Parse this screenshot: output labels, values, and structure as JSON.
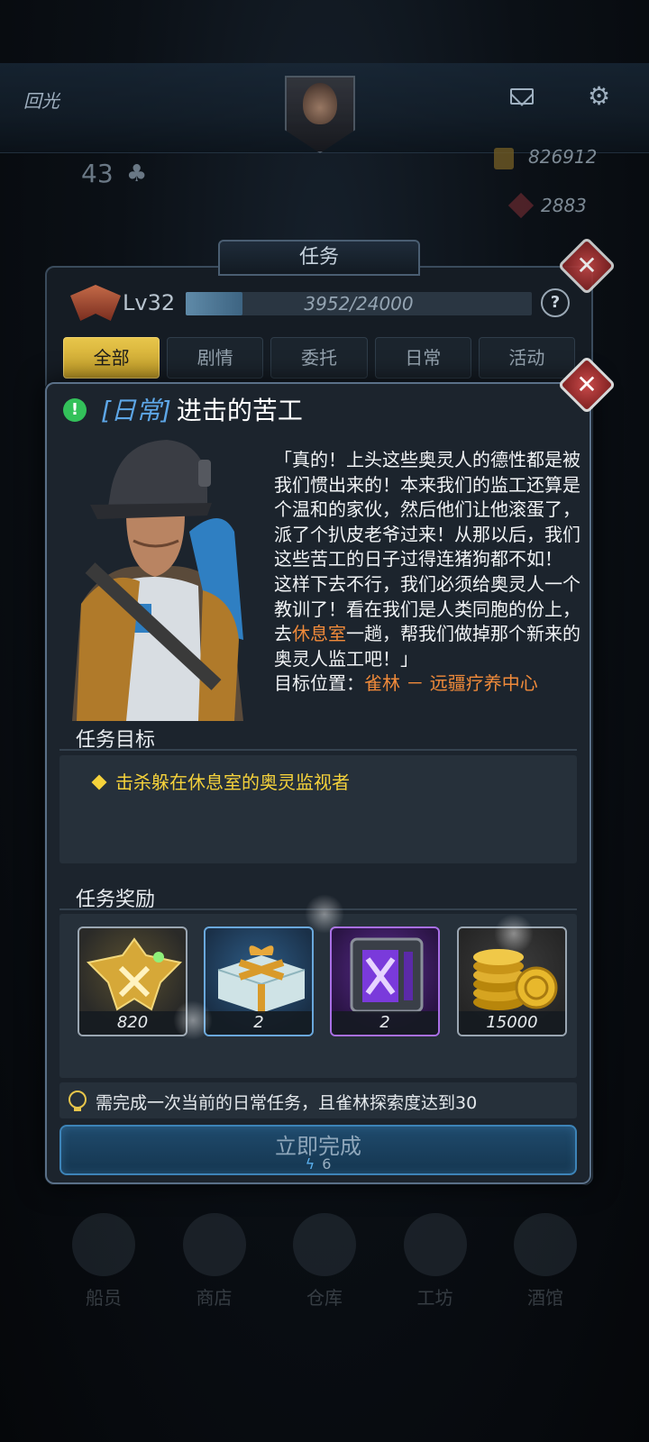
{
  "background": {
    "player_name": "回光",
    "player_level": "43",
    "gold": "826912",
    "gems": "2883",
    "nav": [
      "船员",
      "商店",
      "仓库",
      "工坊",
      "酒馆"
    ]
  },
  "tasks_panel": {
    "title": "任务",
    "level_label": "Lv32",
    "xp_text": "3952/24000",
    "xp_fraction": 0.165,
    "help": "?",
    "tabs": [
      "全部",
      "剧情",
      "委托",
      "日常",
      "活动"
    ],
    "active_tab": 0
  },
  "dialog": {
    "task_type": "[日常]",
    "task_name": "进击的苦工",
    "story_part1": "「真的！上头这些奥灵人的德性都是被我们惯出来的！本来我们的监工还算是个温和的家伙，然后他们让他滚蛋了，派了个扒皮老爷过来！从那以后，我们这些苦工的日子过得连猪狗都不如！\n这样下去不行，我们必须给奥灵人一个教训了！看在我们是人类同胞的份上，去",
    "story_highlight": "休息室",
    "story_part2": "一趟，帮我们做掉那个新来的奥灵人监工吧！」",
    "target_label": "目标位置：",
    "target_location": "雀林 － 远疆疗养中心",
    "objectives_title": "任务目标",
    "objective": "击杀躲在休息室的奥灵监视者",
    "rewards_title": "任务奖励",
    "rewards": [
      {
        "icon": "rank-xp-icon",
        "count": "820"
      },
      {
        "icon": "gift-box-icon",
        "count": "2"
      },
      {
        "icon": "purple-crate-icon",
        "count": "2"
      },
      {
        "icon": "gold-coins-icon",
        "count": "15000"
      }
    ],
    "hint": "需完成一次当前的日常任务，且雀林探索度达到30",
    "complete_button": "立即完成",
    "complete_cost": "6"
  },
  "colors": {
    "accent_gold": "#e7c54b",
    "highlight_orange": "#f08a3a",
    "daily_blue": "#5da6e6",
    "objective_yellow": "#f5d23b"
  }
}
